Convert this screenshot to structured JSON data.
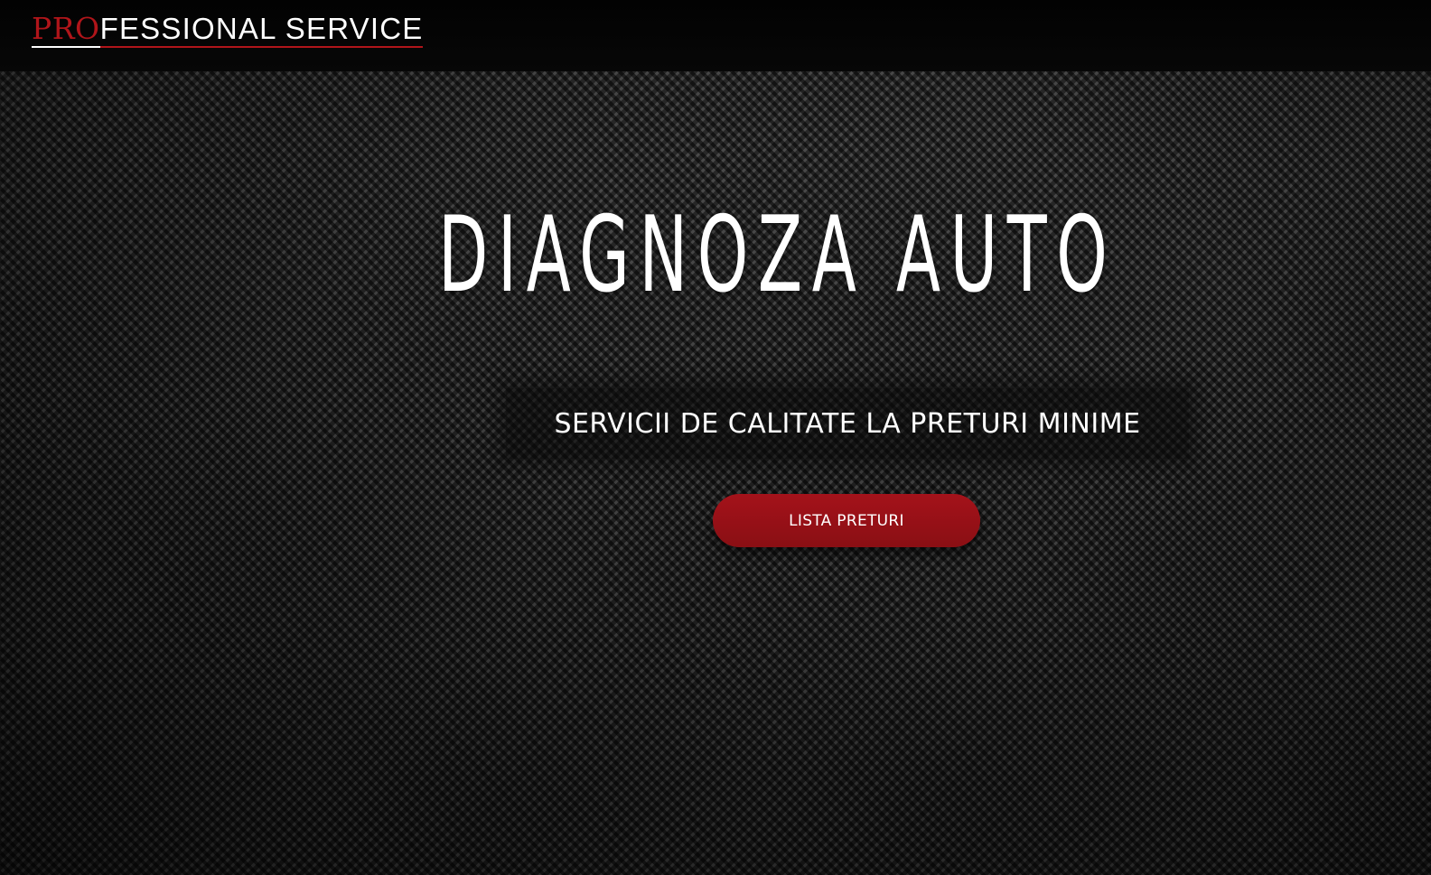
{
  "header": {
    "logo_accent": "PRO",
    "logo_rest": "FESSIONAL SERVICE"
  },
  "hero": {
    "title": "DIAGNOZA AUTO",
    "tagline": "SERVICII DE CALITATE LA PRETURI MINIME",
    "cta_label": "LISTA PRETURI"
  },
  "colors": {
    "brand_red": "#a4121a",
    "header_bg": "#050505",
    "text": "#ffffff",
    "background": "carbon-fiber-dark"
  }
}
